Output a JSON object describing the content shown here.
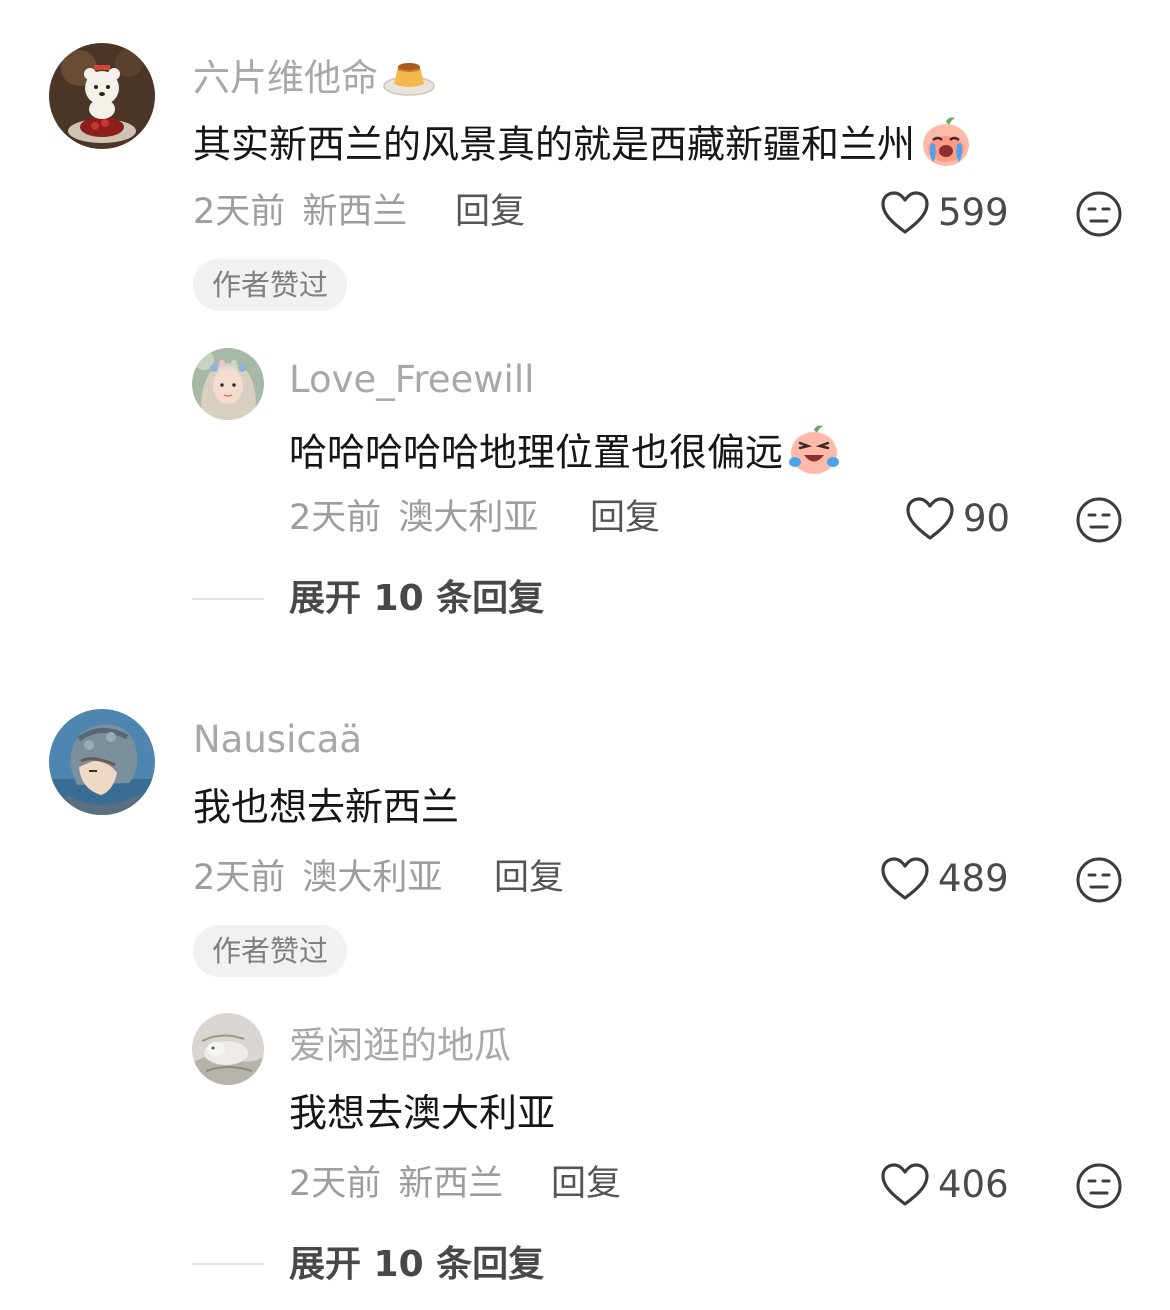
{
  "comments": [
    {
      "username": "六片维他命",
      "username_icon": "pudding-icon",
      "text": "其实新西兰的风景真的就是西藏新疆和兰州",
      "text_emoji": "crying-peach-emoji",
      "time": "2天前",
      "location": "新西兰",
      "reply_label": "回复",
      "likes": "599",
      "badge": "作者赞过",
      "replies": [
        {
          "username": "Love_Freewill",
          "text": "哈哈哈哈哈地理位置也很偏远",
          "text_emoji": "laughing-peach-emoji",
          "time": "2天前",
          "location": "澳大利亚",
          "reply_label": "回复",
          "likes": "90"
        }
      ],
      "expand_label": "展开 10 条回复"
    },
    {
      "username": "Nausicaä",
      "text": "我也想去新西兰",
      "time": "2天前",
      "location": "澳大利亚",
      "reply_label": "回复",
      "likes": "489",
      "badge": "作者赞过",
      "replies": [
        {
          "username": "爱闲逛的地瓜",
          "text": "我想去澳大利亚",
          "time": "2天前",
          "location": "新西兰",
          "reply_label": "回复",
          "likes": "406"
        }
      ],
      "expand_label": "展开 10 条回复"
    }
  ],
  "icons": {
    "like": "heart-outline-icon",
    "dislike": "meh-face-icon"
  },
  "colors": {
    "username": "#a8a8a8",
    "text": "#161616",
    "meta": "#9d9d9d",
    "badge_bg": "#f1f1f1"
  }
}
